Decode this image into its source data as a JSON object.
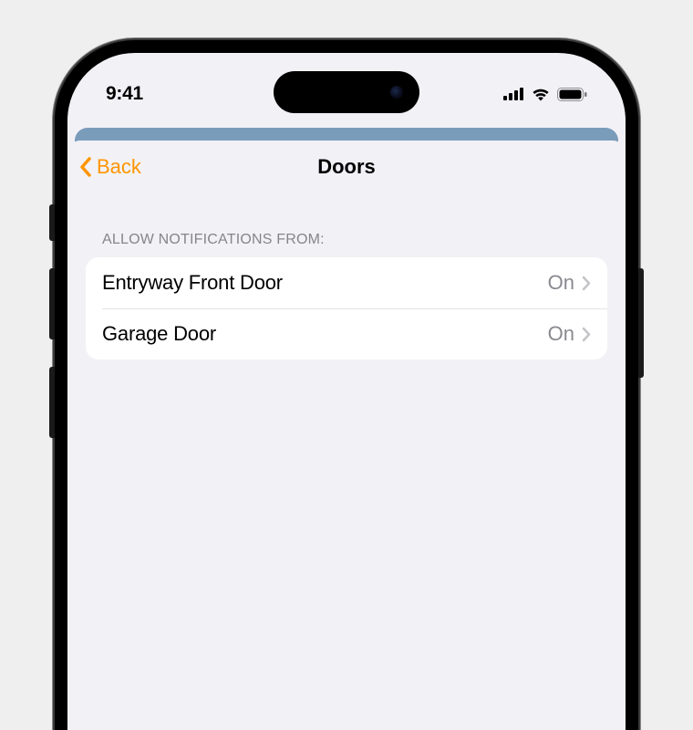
{
  "status": {
    "time": "9:41"
  },
  "nav": {
    "back": "Back",
    "title": "Doors"
  },
  "section": {
    "header": "ALLOW NOTIFICATIONS FROM:"
  },
  "rows": [
    {
      "label": "Entryway Front Door",
      "value": "On"
    },
    {
      "label": "Garage Door",
      "value": "On"
    }
  ],
  "colors": {
    "accent": "#ff9500"
  }
}
